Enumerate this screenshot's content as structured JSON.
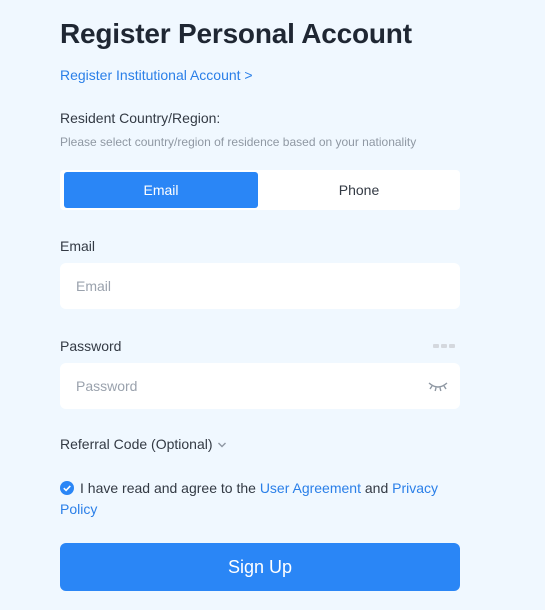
{
  "page": {
    "title": "Register Personal Account",
    "institutional_link": "Register Institutional Account >"
  },
  "country": {
    "label": "Resident Country/Region:",
    "help": "Please select country/region of residence based on your nationality"
  },
  "tabs": [
    {
      "label": "Email",
      "selected": true
    },
    {
      "label": "Phone",
      "selected": false
    }
  ],
  "email": {
    "label": "Email",
    "value": "",
    "placeholder": "Email"
  },
  "password": {
    "label": "Password",
    "value": "",
    "placeholder": "Password",
    "toggle_icon": "eye-closed-icon"
  },
  "referral": {
    "label": "Referral Code (Optional)",
    "icon": "chevron-down-icon"
  },
  "agreement": {
    "checked": true,
    "text_before": "I have read and agree to the ",
    "user_agreement": "User Agreement",
    "text_between": " and ",
    "privacy_policy": "Privacy Policy"
  },
  "signup": {
    "label": "Sign Up"
  },
  "colors": {
    "background": "#f0f8ff",
    "accent": "#2a86f6",
    "link": "#2a7fe8"
  }
}
